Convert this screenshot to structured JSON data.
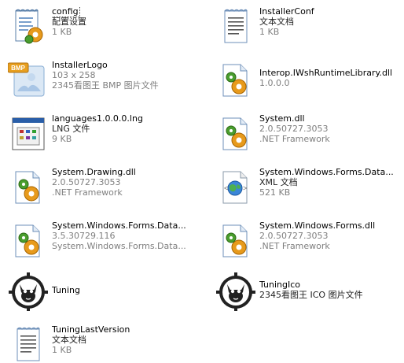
{
  "window": {
    "view": "tiles"
  },
  "files": [
    {
      "name": "config",
      "line2": "配置设置",
      "line3": "1 KB",
      "icon": "config-settings-icon",
      "focused": true
    },
    {
      "name": "InstallerConf",
      "line2": "文本文档",
      "line3": "1 KB",
      "icon": "text-document-icon"
    },
    {
      "name": "InstallerLogo",
      "line2": "103 x 258",
      "line3": "2345看图王 BMP 图片文件",
      "icon": "bmp-image-icon"
    },
    {
      "name": "Interop.IWshRuntimeLibrary.dll",
      "line2": "1.0.0.0",
      "line3": "",
      "icon": "dll-gear-icon"
    },
    {
      "name": "languages1.0.0.0.lng",
      "line2": "LNG 文件",
      "line3": "9 KB",
      "icon": "lng-window-icon"
    },
    {
      "name": "System.dll",
      "line2": "2.0.50727.3053",
      "line3": ".NET Framework",
      "icon": "dll-gear-icon"
    },
    {
      "name": "System.Drawing.dll",
      "line2": "2.0.50727.3053",
      "line3": ".NET Framework",
      "icon": "dll-gear-icon"
    },
    {
      "name": "System.Windows.Forms.Data...",
      "line2": "XML 文档",
      "line3": "521 KB",
      "icon": "xml-globe-icon"
    },
    {
      "name": "System.Windows.Forms.Data...",
      "line2": "3.5.30729.116",
      "line3": "System.Windows.Forms.Data...",
      "icon": "dll-gear-icon"
    },
    {
      "name": "System.Windows.Forms.dll",
      "line2": "2.0.50727.3053",
      "line3": ".NET Framework",
      "icon": "dll-gear-icon"
    },
    {
      "name": "Tuning",
      "line2": "",
      "line3": "",
      "icon": "cat-gear-icon"
    },
    {
      "name": "TuningIco",
      "line2": "2345看图王 ICO 图片文件",
      "line3": "",
      "icon": "cat-gear-icon"
    },
    {
      "name": "TuningLastVersion",
      "line2": "文本文档",
      "line3": "1 KB",
      "icon": "text-document-icon"
    }
  ],
  "colors": {
    "secondary_text": "#7f7f7f",
    "primary_text": "#000000",
    "bmp_badge": "#e8a020",
    "gear_orange": "#e79a1c",
    "gear_green": "#4a9d2e",
    "doc_blue": "#4a86c8"
  }
}
